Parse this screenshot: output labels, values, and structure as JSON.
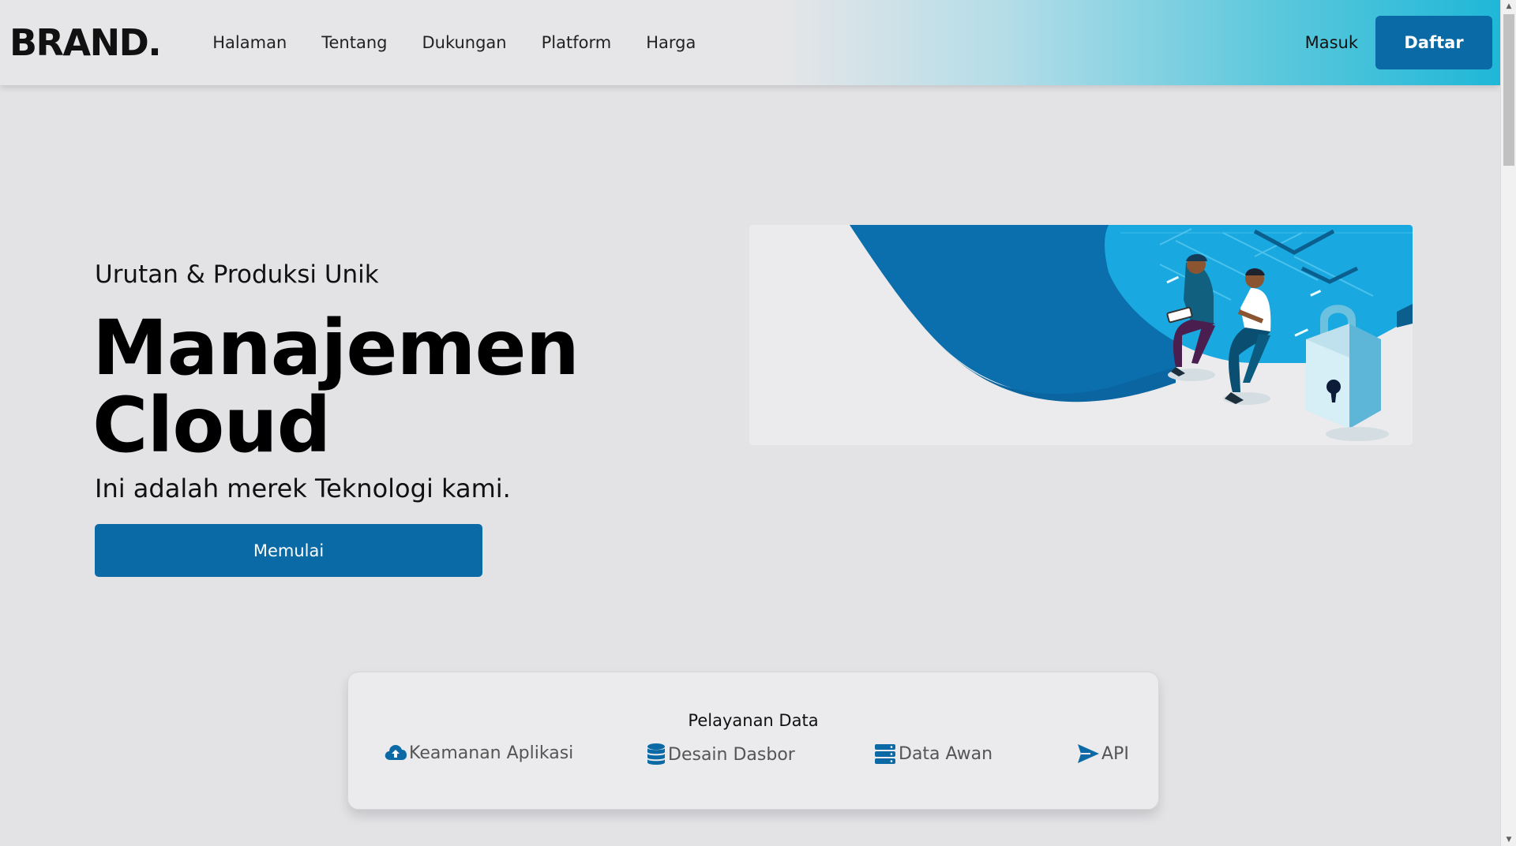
{
  "header": {
    "brand": "BRAND.",
    "nav": [
      "Halaman",
      "Tentang",
      "Dukungan",
      "Platform",
      "Harga"
    ],
    "login_label": "Masuk",
    "signup_label": "Daftar"
  },
  "hero": {
    "subtitle": "Urutan & Produksi Unik",
    "title_line1": "Manajemen",
    "title_line2": "Cloud",
    "description": "Ini adalah merek Teknologi kami.",
    "cta_label": "Memulai"
  },
  "services": {
    "title": "Pelayanan Data",
    "items": [
      {
        "label": "Keamanan Aplikasi",
        "icon": "cloud-upload-icon"
      },
      {
        "label": "Desain Dasbor",
        "icon": "database-icon"
      },
      {
        "label": "Data Awan",
        "icon": "server-icon"
      },
      {
        "label": "API",
        "icon": "paper-plane-icon"
      }
    ]
  },
  "colors": {
    "primary": "#0a6aa6",
    "background": "#e3e3e6",
    "header_gradient_end": "#1fb7d8",
    "illustration_accent": "#0d9fd8"
  }
}
